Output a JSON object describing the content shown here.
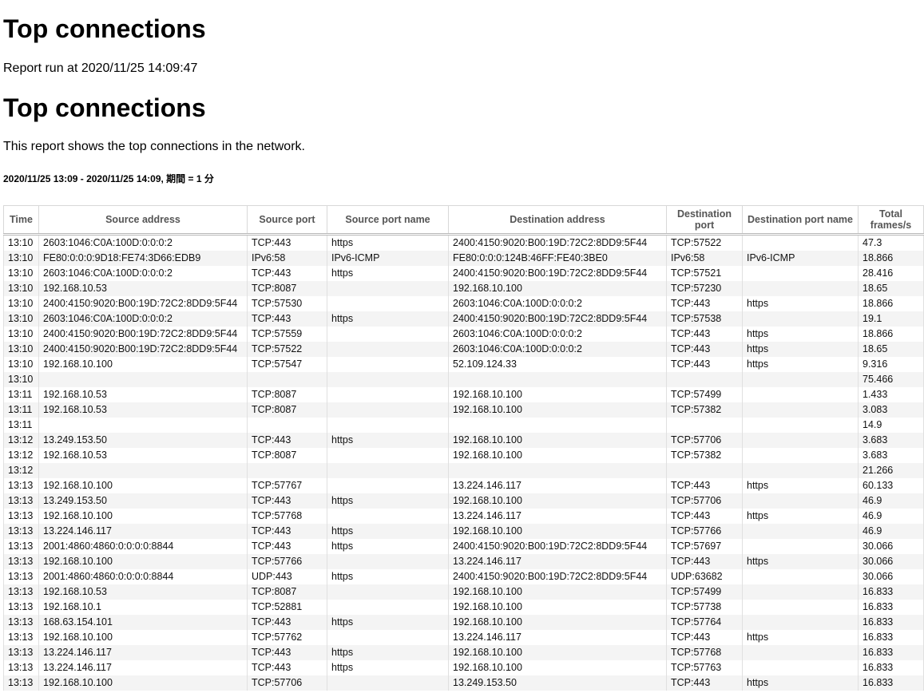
{
  "title": "Top connections",
  "run_at": "Report run at 2020/11/25 14:09:47",
  "section_title": "Top connections",
  "description": "This report shows the top connections in the network.",
  "period": "2020/11/25 13:09 - 2020/11/25 14:09, 期間 = 1 分",
  "table": {
    "headers": [
      "Time",
      "Source address",
      "Source port",
      "Source port name",
      "Destination address",
      "Destination port",
      "Destination port name",
      "Total frames/s"
    ],
    "rows": [
      [
        "13:10",
        "2603:1046:C0A:100D:0:0:0:2",
        "TCP:443",
        "https",
        "2400:4150:9020:B00:19D:72C2:8DD9:5F44",
        "TCP:57522",
        "",
        "47.3"
      ],
      [
        "13:10",
        "FE80:0:0:0:9D18:FE74:3D66:EDB9",
        "IPv6:58",
        "IPv6-ICMP",
        "FE80:0:0:0:124B:46FF:FE40:3BE0",
        "IPv6:58",
        "IPv6-ICMP",
        "18.866"
      ],
      [
        "13:10",
        "2603:1046:C0A:100D:0:0:0:2",
        "TCP:443",
        "https",
        "2400:4150:9020:B00:19D:72C2:8DD9:5F44",
        "TCP:57521",
        "",
        "28.416"
      ],
      [
        "13:10",
        "192.168.10.53",
        "TCP:8087",
        "",
        "192.168.10.100",
        "TCP:57230",
        "",
        "18.65"
      ],
      [
        "13:10",
        "2400:4150:9020:B00:19D:72C2:8DD9:5F44",
        "TCP:57530",
        "",
        "2603:1046:C0A:100D:0:0:0:2",
        "TCP:443",
        "https",
        "18.866"
      ],
      [
        "13:10",
        "2603:1046:C0A:100D:0:0:0:2",
        "TCP:443",
        "https",
        "2400:4150:9020:B00:19D:72C2:8DD9:5F44",
        "TCP:57538",
        "",
        "19.1"
      ],
      [
        "13:10",
        "2400:4150:9020:B00:19D:72C2:8DD9:5F44",
        "TCP:57559",
        "",
        "2603:1046:C0A:100D:0:0:0:2",
        "TCP:443",
        "https",
        "18.866"
      ],
      [
        "13:10",
        "2400:4150:9020:B00:19D:72C2:8DD9:5F44",
        "TCP:57522",
        "",
        "2603:1046:C0A:100D:0:0:0:2",
        "TCP:443",
        "https",
        "18.65"
      ],
      [
        "13:10",
        "192.168.10.100",
        "TCP:57547",
        "",
        "52.109.124.33",
        "TCP:443",
        "https",
        "9.316"
      ],
      [
        "13:10",
        "",
        "",
        "",
        "",
        "",
        "",
        "75.466"
      ],
      [
        "13:11",
        "192.168.10.53",
        "TCP:8087",
        "",
        "192.168.10.100",
        "TCP:57499",
        "",
        "1.433"
      ],
      [
        "13:11",
        "192.168.10.53",
        "TCP:8087",
        "",
        "192.168.10.100",
        "TCP:57382",
        "",
        "3.083"
      ],
      [
        "13:11",
        "",
        "",
        "",
        "",
        "",
        "",
        "14.9"
      ],
      [
        "13:12",
        "13.249.153.50",
        "TCP:443",
        "https",
        "192.168.10.100",
        "TCP:57706",
        "",
        "3.683"
      ],
      [
        "13:12",
        "192.168.10.53",
        "TCP:8087",
        "",
        "192.168.10.100",
        "TCP:57382",
        "",
        "3.683"
      ],
      [
        "13:12",
        "",
        "",
        "",
        "",
        "",
        "",
        "21.266"
      ],
      [
        "13:13",
        "192.168.10.100",
        "TCP:57767",
        "",
        "13.224.146.117",
        "TCP:443",
        "https",
        "60.133"
      ],
      [
        "13:13",
        "13.249.153.50",
        "TCP:443",
        "https",
        "192.168.10.100",
        "TCP:57706",
        "",
        "46.9"
      ],
      [
        "13:13",
        "192.168.10.100",
        "TCP:57768",
        "",
        "13.224.146.117",
        "TCP:443",
        "https",
        "46.9"
      ],
      [
        "13:13",
        "13.224.146.117",
        "TCP:443",
        "https",
        "192.168.10.100",
        "TCP:57766",
        "",
        "46.9"
      ],
      [
        "13:13",
        "2001:4860:4860:0:0:0:0:8844",
        "TCP:443",
        "https",
        "2400:4150:9020:B00:19D:72C2:8DD9:5F44",
        "TCP:57697",
        "",
        "30.066"
      ],
      [
        "13:13",
        "192.168.10.100",
        "TCP:57766",
        "",
        "13.224.146.117",
        "TCP:443",
        "https",
        "30.066"
      ],
      [
        "13:13",
        "2001:4860:4860:0:0:0:0:8844",
        "UDP:443",
        "https",
        "2400:4150:9020:B00:19D:72C2:8DD9:5F44",
        "UDP:63682",
        "",
        "30.066"
      ],
      [
        "13:13",
        "192.168.10.53",
        "TCP:8087",
        "",
        "192.168.10.100",
        "TCP:57499",
        "",
        "16.833"
      ],
      [
        "13:13",
        "192.168.10.1",
        "TCP:52881",
        "",
        "192.168.10.100",
        "TCP:57738",
        "",
        "16.833"
      ],
      [
        "13:13",
        "168.63.154.101",
        "TCP:443",
        "https",
        "192.168.10.100",
        "TCP:57764",
        "",
        "16.833"
      ],
      [
        "13:13",
        "192.168.10.100",
        "TCP:57762",
        "",
        "13.224.146.117",
        "TCP:443",
        "https",
        "16.833"
      ],
      [
        "13:13",
        "13.224.146.117",
        "TCP:443",
        "https",
        "192.168.10.100",
        "TCP:57768",
        "",
        "16.833"
      ],
      [
        "13:13",
        "13.224.146.117",
        "TCP:443",
        "https",
        "192.168.10.100",
        "TCP:57763",
        "",
        "16.833"
      ],
      [
        "13:13",
        "192.168.10.100",
        "TCP:57706",
        "",
        "13.249.153.50",
        "TCP:443",
        "https",
        "16.833"
      ]
    ]
  }
}
